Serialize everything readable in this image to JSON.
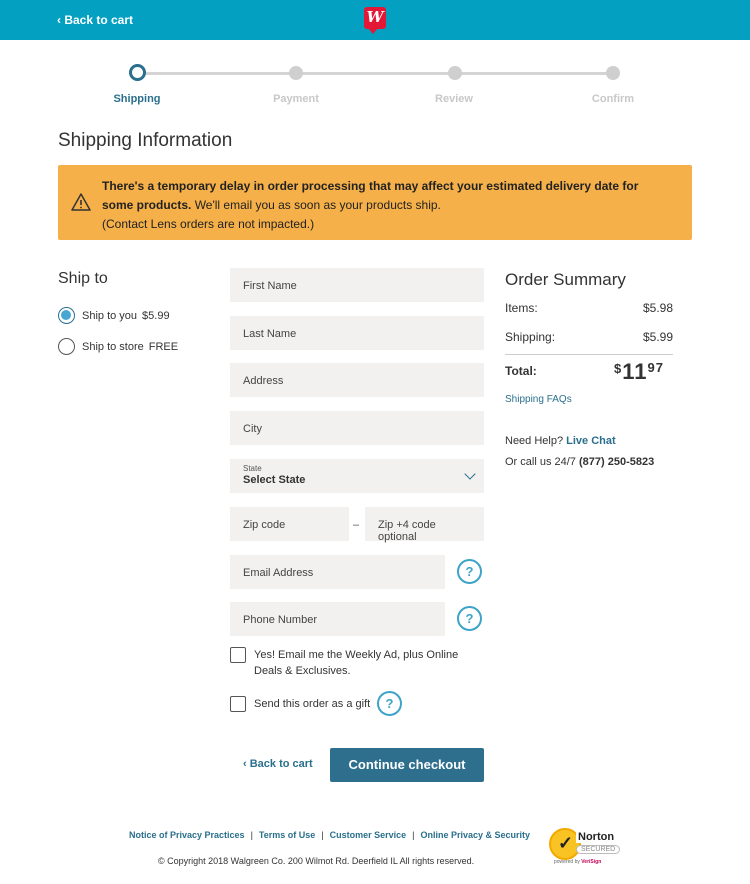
{
  "header": {
    "back_label": "‹ Back to cart",
    "logo_letter": "W"
  },
  "steps": [
    {
      "label": "Shipping",
      "active": true
    },
    {
      "label": "Payment",
      "active": false
    },
    {
      "label": "Review",
      "active": false
    },
    {
      "label": "Confirm",
      "active": false
    }
  ],
  "page_title": "Shipping Information",
  "alert": {
    "bold": "There's a temporary delay in order processing that may affect your estimated delivery date for some products.",
    "rest": " We'll email you as soon as your products ship.",
    "note": "(Contact Lens orders are not impacted.)",
    "icon": "warning-icon"
  },
  "ship_to": {
    "title": "Ship to",
    "options": [
      {
        "label": "Ship to you",
        "price": "$5.99",
        "checked": true
      },
      {
        "label": "Ship to store",
        "price": "FREE",
        "checked": false
      }
    ]
  },
  "form": {
    "first_name": "First Name",
    "last_name": "Last Name",
    "address": "Address",
    "city": "City",
    "state_label": "State",
    "state_value": "Select State",
    "zip": "Zip code",
    "zip_dash": "–",
    "zip4": "Zip +4 code optional",
    "email": "Email Address",
    "phone": "Phone Number",
    "help_glyph": "?",
    "weekly_ad": "Yes! Email me the Weekly Ad, plus Online Deals & Exclusives.",
    "gift": "Send this order as a gift"
  },
  "actions": {
    "back": "‹ Back to cart",
    "continue": "Continue checkout"
  },
  "summary": {
    "title": "Order Summary",
    "items_label": "Items:",
    "items_value": "$5.98",
    "shipping_label": "Shipping:",
    "shipping_value": "$5.99",
    "total_label": "Total:",
    "total_currency": "$",
    "total_dollars": "11",
    "total_cents": "97",
    "faq_link": "Shipping FAQs",
    "help_prefix": "Need Help?",
    "live_chat": "Live Chat",
    "call_prefix": "Or call us 24/7",
    "phone": "(877) 250-5823"
  },
  "footer": {
    "links": [
      "Notice of Privacy Practices",
      "Terms of Use",
      "Customer Service",
      "Online Privacy & Security"
    ],
    "separator": "|",
    "copyright": "© Copyright 2018 Walgreen Co. 200 Wilmot Rd. Deerfield IL All rights reserved.",
    "norton_brand": "Norton",
    "norton_secured": "SECURED",
    "norton_powered_prefix": "powered by",
    "norton_powered_brand": "VeriSign"
  },
  "colors": {
    "header_bg": "#04a0c2",
    "brand_red": "#e31837",
    "alert_bg": "#f5b049",
    "primary": "#2e6f8e",
    "accent": "#46a7d3"
  }
}
